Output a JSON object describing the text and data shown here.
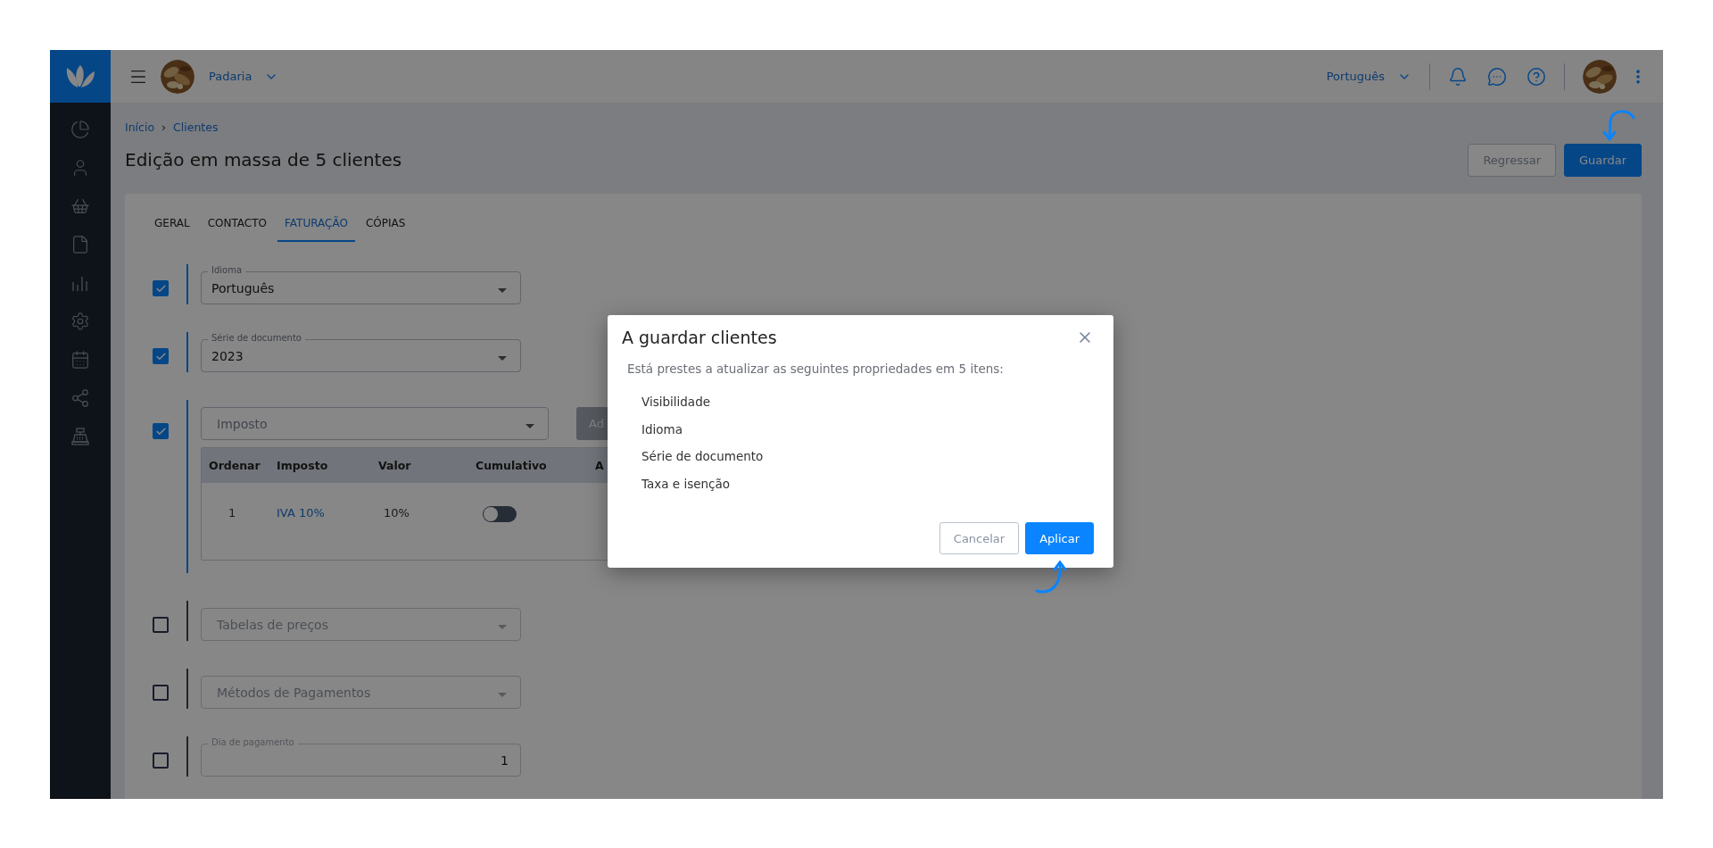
{
  "topbar": {
    "company": "Padaria",
    "language": "Português"
  },
  "breadcrumb": {
    "items": [
      "Início",
      "Clientes"
    ],
    "separator": "›"
  },
  "title": "Edição em massa de 5 clientes",
  "actions": [
    {
      "label": "Regressar",
      "kind": "secondary"
    },
    {
      "label": "Guardar",
      "kind": "primary"
    }
  ],
  "tabs": [
    {
      "label": "GERAL",
      "selected": false
    },
    {
      "label": "CONTACTO",
      "selected": false
    },
    {
      "label": "FATURAÇÃO",
      "selected": true
    },
    {
      "label": "CÓPIAS",
      "selected": false
    }
  ],
  "fields": [
    {
      "kind": "select",
      "checked": true,
      "label": "Idioma",
      "value": "Português"
    },
    {
      "kind": "select",
      "checked": true,
      "label": "Série de documento",
      "value": "2023"
    },
    {
      "kind": "tax",
      "checked": true,
      "placeholder": "Imposto",
      "button": "Ad",
      "table": {
        "columns": [
          "Ordenar",
          "Imposto",
          "Valor",
          "Cumulativo",
          "A"
        ],
        "rows": [
          {
            "order": "1",
            "tax": "IVA 10%",
            "value": "10%",
            "cumulative": false
          }
        ]
      }
    },
    {
      "kind": "select",
      "checked": false,
      "placeholder": "Tabelas de preços"
    },
    {
      "kind": "select",
      "checked": false,
      "placeholder": "Métodos de Pagamentos"
    },
    {
      "kind": "number",
      "checked": false,
      "label": "Dia de pagamento",
      "value": "1"
    }
  ],
  "dialog": {
    "title": "A guardar clientes",
    "message": "Está prestes a atualizar as seguintes propriedades em 5 itens:",
    "items": [
      "Visibilidade",
      "Idioma",
      "Série de documento",
      "Taxa e isenção"
    ],
    "buttons": [
      {
        "label": "Cancelar",
        "kind": "secondary"
      },
      {
        "label": "Aplicar",
        "kind": "primary"
      }
    ]
  }
}
